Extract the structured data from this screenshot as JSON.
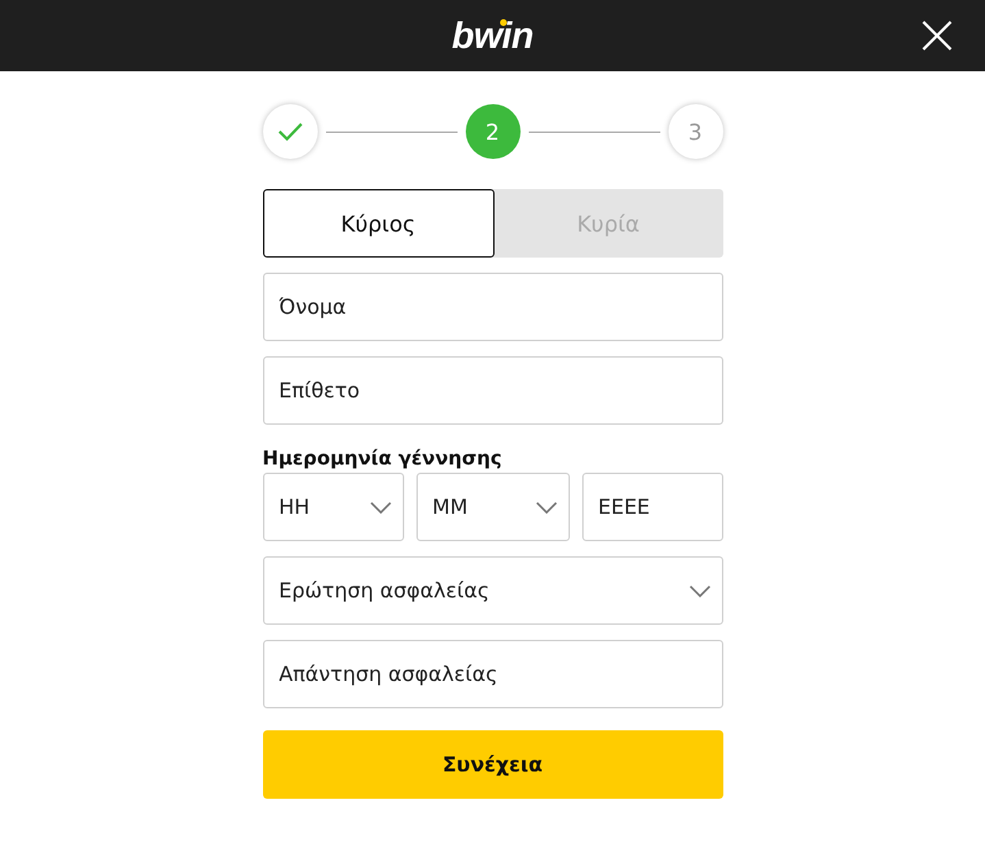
{
  "header": {
    "logo": "bwin"
  },
  "steps": [
    {
      "kind": "done"
    },
    {
      "kind": "current",
      "label": "2"
    },
    {
      "kind": "upcoming",
      "label": "3"
    }
  ],
  "gender_tabs": [
    {
      "label": "Κύριος",
      "selected": true
    },
    {
      "label": "Κυρία",
      "selected": false
    }
  ],
  "name_fields": [
    {
      "kind": "text",
      "placeholder": "Όνομα"
    },
    {
      "kind": "text",
      "placeholder": "Επίθετο"
    }
  ],
  "birth_date": {
    "label": "Ημερομηνία γέννησης",
    "fields": [
      {
        "kind": "select",
        "placeholder": "ΗΗ"
      },
      {
        "kind": "select",
        "placeholder": "ΜΜ"
      },
      {
        "kind": "text",
        "placeholder": "ΕΕΕΕ"
      }
    ]
  },
  "security_fields": [
    {
      "kind": "select",
      "placeholder": "Ερώτηση ασφαλείας"
    },
    {
      "kind": "text",
      "placeholder": "Απάντηση ασφαλείας"
    }
  ],
  "submit_button": "Συνέχεια"
}
